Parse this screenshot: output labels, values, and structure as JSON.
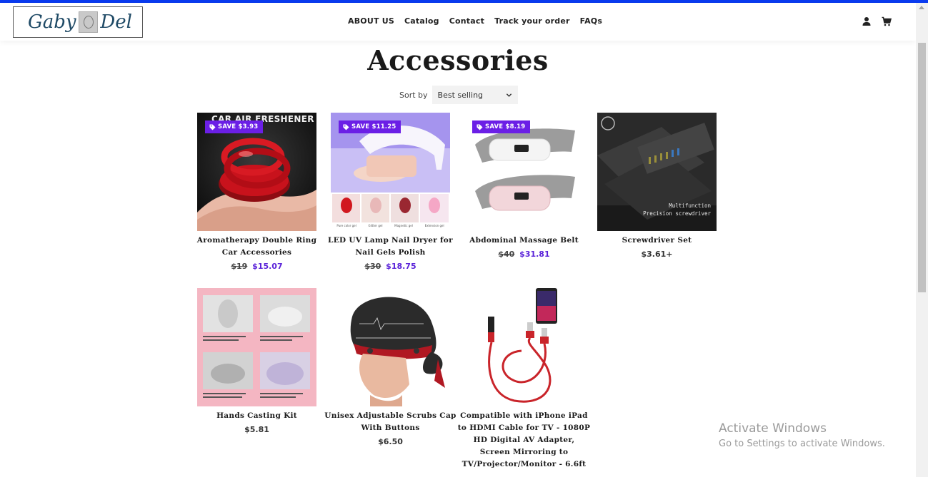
{
  "brand": {
    "logo_left": "Gaby",
    "logo_right": "Del"
  },
  "nav": [
    "ABOUT US",
    "Catalog",
    "Contact",
    "Track your order",
    "FAQs"
  ],
  "header_icons": [
    "user-icon",
    "cart-icon"
  ],
  "page": {
    "title": "Accessories"
  },
  "sort": {
    "label": "Sort by",
    "value": "Best selling"
  },
  "colors": {
    "accent": "#6b1fe6",
    "sale_price": "#5a22d9",
    "top_bar": "#0a3bf0"
  },
  "products": [
    {
      "name": "Aromatherapy Double Ring Car Accessories",
      "badge": "SAVE $3.93",
      "old_price": "$19",
      "price": "$15.07",
      "image_text": "CAR AIR FRESHENER"
    },
    {
      "name": "LED UV Lamp Nail Dryer for Nail Gels Polish",
      "badge": "SAVE $11.25",
      "old_price": "$30",
      "price": "$18.75",
      "image_captions": [
        "Pure color gel",
        "Glitter gel",
        "Magnetic gel",
        "Extension gel"
      ]
    },
    {
      "name": "Abdominal Massage Belt",
      "badge": "SAVE $8.19",
      "old_price": "$40",
      "price": "$31.81"
    },
    {
      "name": "Screwdriver Set",
      "badge": "",
      "old_price": "",
      "price": "$3.61+",
      "image_text_1": "Multifunction",
      "image_text_2": "Precision screwdriver"
    },
    {
      "name": "Hands Casting Kit",
      "badge": "",
      "old_price": "",
      "price": "$5.81"
    },
    {
      "name": "Unisex Adjustable Scrubs Cap With Buttons",
      "badge": "",
      "old_price": "",
      "price": "$6.50"
    },
    {
      "name": "Compatible with iPhone iPad to HDMI Cable for TV - 1080P HD Digital AV Adapter, Screen Mirroring to TV/Projector/Monitor - 6.6ft",
      "badge": "",
      "old_price": "",
      "price": ""
    }
  ],
  "watermark": {
    "line1": "Activate Windows",
    "line2": "Go to Settings to activate Windows."
  }
}
